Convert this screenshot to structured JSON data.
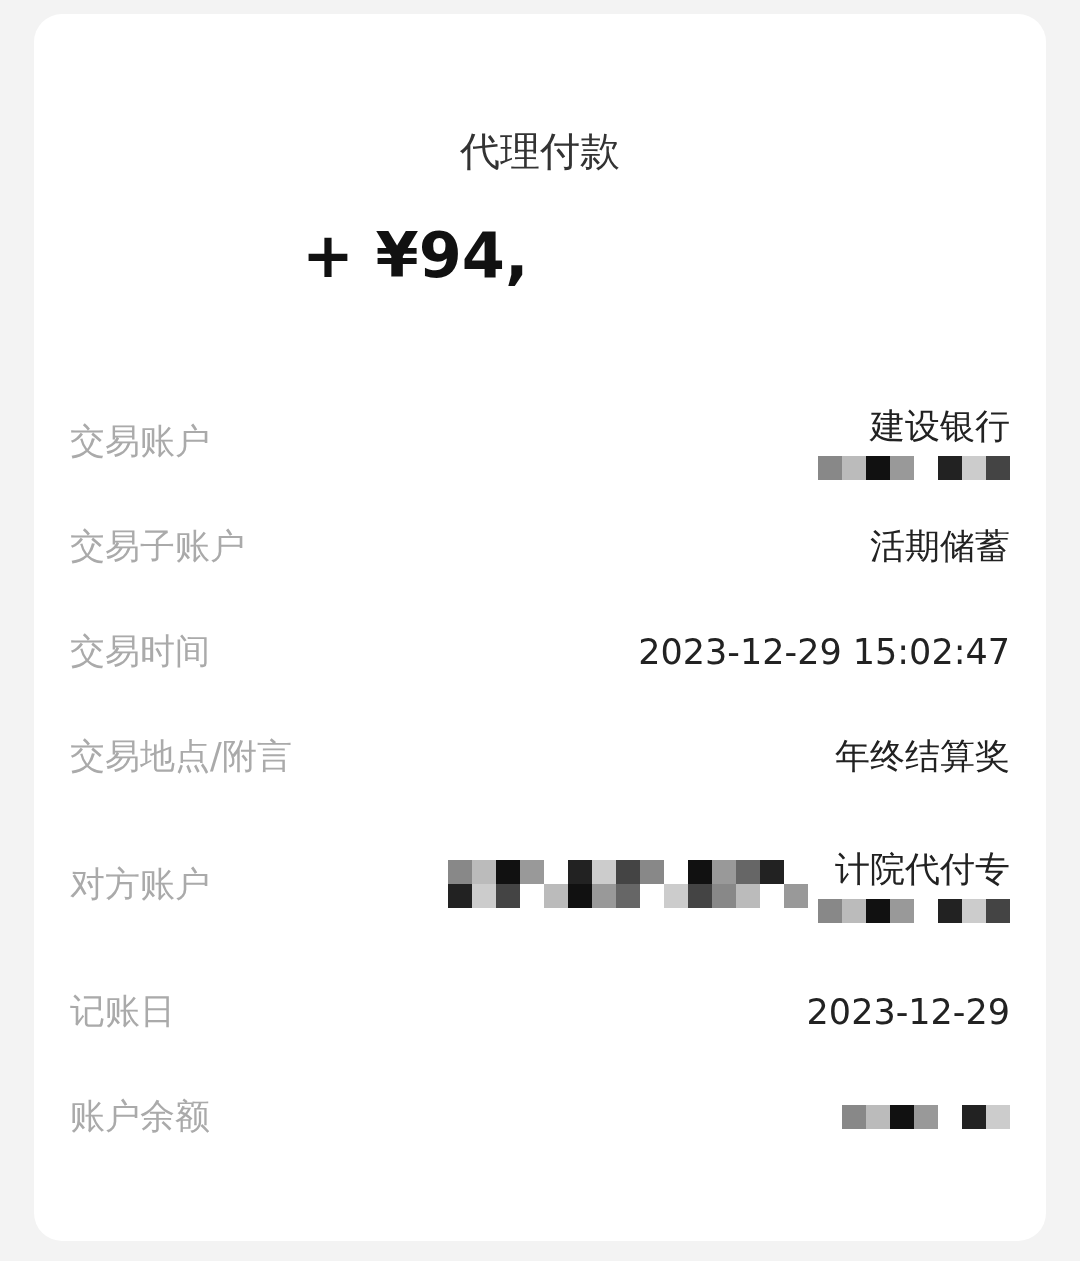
{
  "title": "代理付款",
  "amount": "+ ¥94,",
  "rows": [
    {
      "label": "交易账户",
      "value": "建设银行",
      "redacted": true
    },
    {
      "label": "交易子账户",
      "value": "活期储蓄",
      "redacted": false
    },
    {
      "label": "交易时间",
      "value": "2023-12-29 15:02:47",
      "redacted": false
    },
    {
      "label": "交易地点/附言",
      "value": "年终结算奖",
      "redacted": false
    },
    {
      "label": "对方账户",
      "value": "计院代付专",
      "redacted": true
    },
    {
      "label": "记账日",
      "value": "2023-12-29",
      "redacted": false
    },
    {
      "label": "账户余额",
      "value": "",
      "redacted": true
    }
  ]
}
